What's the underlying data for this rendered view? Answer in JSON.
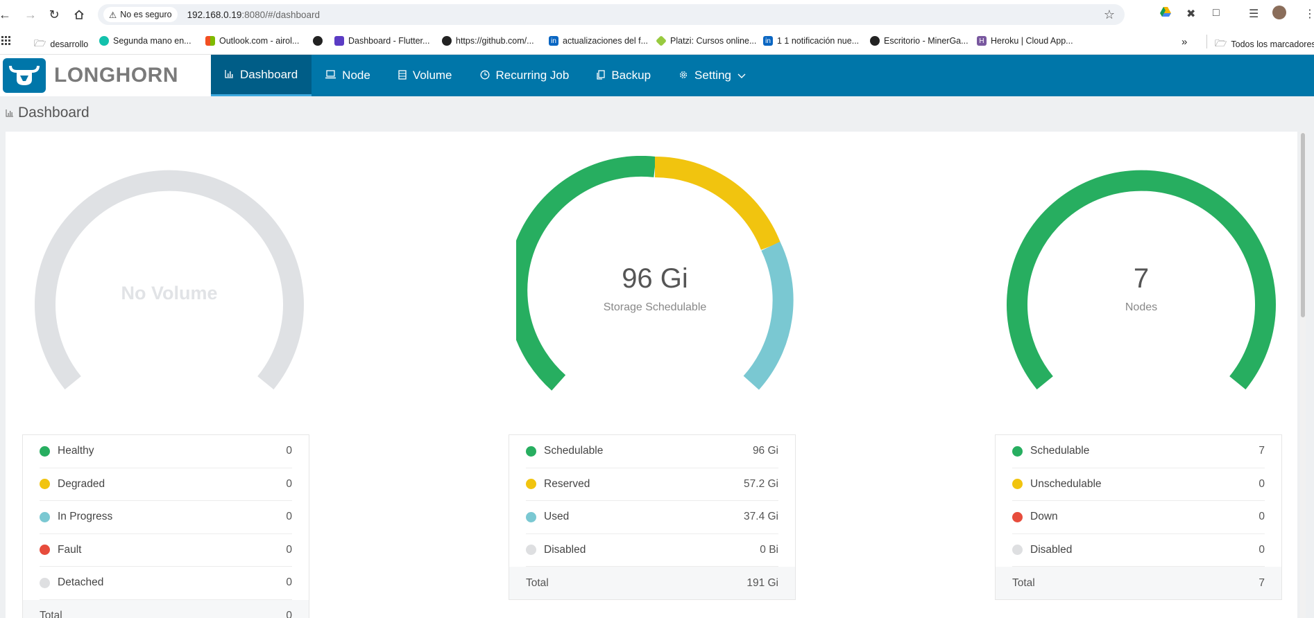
{
  "browser": {
    "security_label": "No es seguro",
    "url_host": "192.168.0.19",
    "url_rest": ":8080/#/dashboard",
    "bookmarks": [
      {
        "label": "desarrollo"
      },
      {
        "label": "Segunda mano en..."
      },
      {
        "label": "Outlook.com - airol..."
      },
      {
        "label": ""
      },
      {
        "label": "Dashboard - Flutter..."
      },
      {
        "label": "https://github.com/..."
      },
      {
        "label": "actualizaciones del f..."
      },
      {
        "label": "Platzi: Cursos online..."
      },
      {
        "label": "1 1 notificación nue..."
      },
      {
        "label": "Escritorio - MinerGa..."
      },
      {
        "label": "Heroku | Cloud App..."
      }
    ],
    "all_bookmarks": "Todos los marcadores"
  },
  "app": {
    "brand": "LONGHORN",
    "menu": [
      {
        "label": "Dashboard",
        "icon": "bar-chart-icon"
      },
      {
        "label": "Node",
        "icon": "laptop-icon"
      },
      {
        "label": "Volume",
        "icon": "database-icon"
      },
      {
        "label": "Recurring Job",
        "icon": "clock-icon"
      },
      {
        "label": "Backup",
        "icon": "copy-icon"
      },
      {
        "label": "Setting",
        "icon": "gear-icon"
      }
    ],
    "accent_color": "#0076a9"
  },
  "page": {
    "title": "Dashboard"
  },
  "volume": {
    "empty_text": "No Volume",
    "legend": [
      {
        "label": "Healthy",
        "value": "0",
        "color": "#27ae60"
      },
      {
        "label": "Degraded",
        "value": "0",
        "color": "#f1c40f"
      },
      {
        "label": "In Progress",
        "value": "0",
        "color": "#7ac8d2"
      },
      {
        "label": "Fault",
        "value": "0",
        "color": "#e74c3c"
      },
      {
        "label": "Detached",
        "value": "0",
        "color": "#dedfe1"
      }
    ],
    "total_label": "Total",
    "total_value": "0"
  },
  "storage": {
    "value": "96 Gi",
    "label": "Storage Schedulable",
    "fractions": {
      "schedulable": 0.5,
      "reserved": 0.3,
      "used": 0.2
    },
    "legend": [
      {
        "label": "Schedulable",
        "value": "96 Gi",
        "color": "#27ae60"
      },
      {
        "label": "Reserved",
        "value": "57.2 Gi",
        "color": "#f1c40f"
      },
      {
        "label": "Used",
        "value": "37.4 Gi",
        "color": "#7ac8d2"
      },
      {
        "label": "Disabled",
        "value": "0 Bi",
        "color": "#dedfe1"
      }
    ],
    "total_label": "Total",
    "total_value": "191 Gi"
  },
  "nodes": {
    "value": "7",
    "label": "Nodes",
    "legend": [
      {
        "label": "Schedulable",
        "value": "7",
        "color": "#27ae60"
      },
      {
        "label": "Unschedulable",
        "value": "0",
        "color": "#f1c40f"
      },
      {
        "label": "Down",
        "value": "0",
        "color": "#e74c3c"
      },
      {
        "label": "Disabled",
        "value": "0",
        "color": "#dedfe1"
      }
    ],
    "total_label": "Total",
    "total_value": "7"
  }
}
